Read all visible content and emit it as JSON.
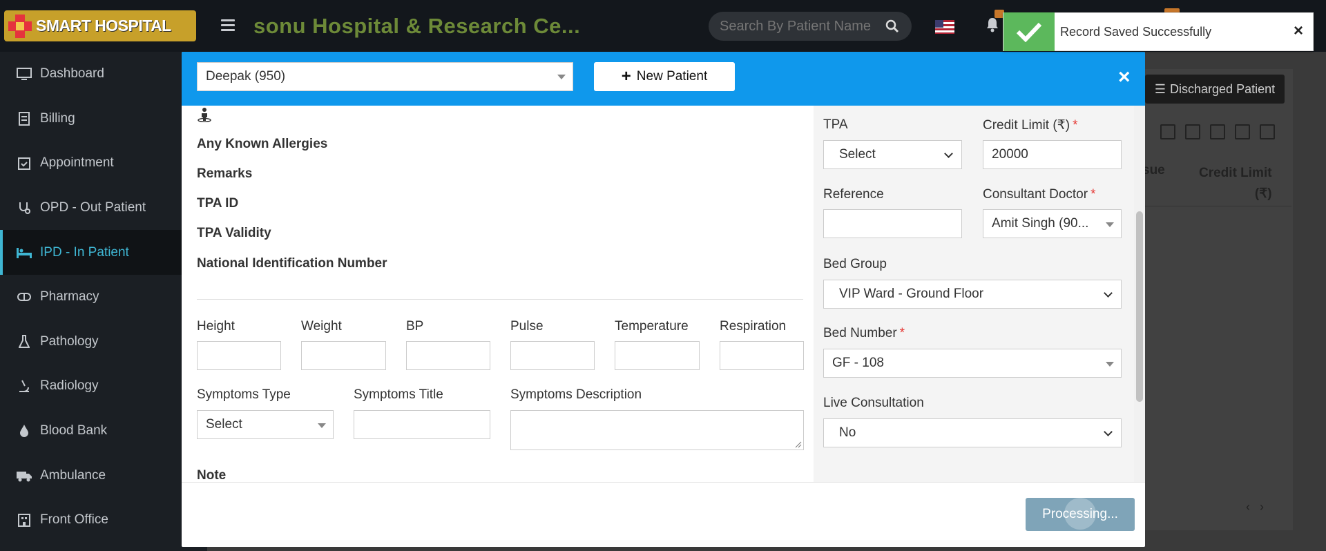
{
  "header": {
    "logo_text": "SMART HOSPITAL",
    "hospital_name": "sonu Hospital & Research Ce...",
    "search_placeholder": "Search By Patient Name"
  },
  "toast": {
    "message": "Record Saved Successfully",
    "close": "×"
  },
  "sidebar": {
    "items": [
      {
        "label": "Dashboard"
      },
      {
        "label": "Billing"
      },
      {
        "label": "Appointment"
      },
      {
        "label": "OPD - Out Patient"
      },
      {
        "label": "IPD - In Patient"
      },
      {
        "label": "Pharmacy"
      },
      {
        "label": "Pathology"
      },
      {
        "label": "Radiology"
      },
      {
        "label": "Blood Bank"
      },
      {
        "label": "Ambulance"
      },
      {
        "label": "Front Office"
      }
    ]
  },
  "background": {
    "discharged_button": "Discharged Patient",
    "col_issue": "sue",
    "col_credit_line1": "Credit Limit",
    "col_credit_line2": "(₹)"
  },
  "modal": {
    "patient_value": "Deepak (950)",
    "new_patient_label": "New Patient",
    "close": "×",
    "info_labels": {
      "allergies": "Any Known Allergies",
      "remarks": "Remarks",
      "tpa_id": "TPA ID",
      "tpa_validity": "TPA Validity",
      "nin": "National Identification Number"
    },
    "vitals": {
      "height": "Height",
      "weight": "Weight",
      "bp": "BP",
      "pulse": "Pulse",
      "temperature": "Temperature",
      "respiration": "Respiration"
    },
    "symptoms_type": {
      "label": "Symptoms Type",
      "value": "Select"
    },
    "symptoms_title": "Symptoms Title",
    "symptoms_description": "Symptoms Description",
    "note": "Note",
    "tpa": {
      "label": "TPA",
      "value": "Select"
    },
    "credit_limit": {
      "label": "Credit Limit (₹)",
      "value": "20000"
    },
    "reference": {
      "label": "Reference",
      "value": ""
    },
    "consultant": {
      "label": "Consultant Doctor",
      "value": "Amit Singh (90..."
    },
    "bed_group": {
      "label": "Bed Group",
      "value": "VIP Ward - Ground Floor"
    },
    "bed_number": {
      "label": "Bed Number",
      "value": "GF - 108"
    },
    "live_consultation": {
      "label": "Live Consultation",
      "value": "No"
    },
    "required_mark": "*",
    "processing_label": "Processing..."
  }
}
